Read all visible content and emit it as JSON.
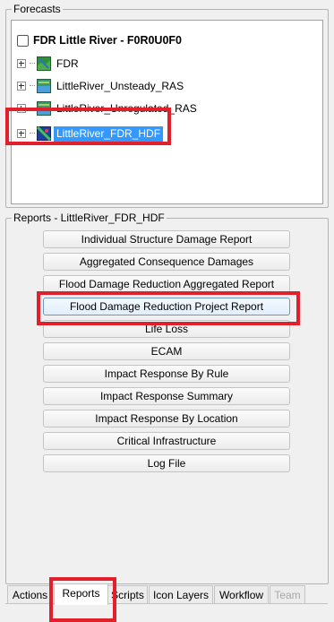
{
  "forecasts": {
    "title": "Forecasts",
    "root_label": "FDR Little River - F0R0U0F0",
    "items": [
      {
        "label": "FDR",
        "icon": "forecast-map-icon"
      },
      {
        "label": "LittleRiver_Unsteady_RAS",
        "icon": "ras-map-icon"
      },
      {
        "label": "LittleRiver_Unregulated_RAS",
        "icon": "ras-map-icon"
      },
      {
        "label": "LittleRiver_FDR_HDF",
        "icon": "hdf-map-icon",
        "selected": true
      }
    ]
  },
  "reports": {
    "title": "Reports - LittleRiver_FDR_HDF",
    "buttons": [
      "Individual Structure Damage Report",
      "Aggregated Consequence Damages",
      "Flood Damage Reduction Aggregated Report",
      "Flood Damage Reduction Project Report",
      "Life Loss",
      "ECAM",
      "Impact Response By Rule",
      "Impact Response Summary",
      "Impact Response By Location",
      "Critical Infrastructure",
      "Log File"
    ]
  },
  "tabs": {
    "items": [
      "Actions",
      "Reports",
      "Scripts",
      "Icon Layers",
      "Workflow",
      "Team"
    ],
    "active": "Reports",
    "disabled": [
      "Team"
    ]
  },
  "colors": {
    "highlight_box": "#e0202a",
    "selection": "#3399ff"
  }
}
